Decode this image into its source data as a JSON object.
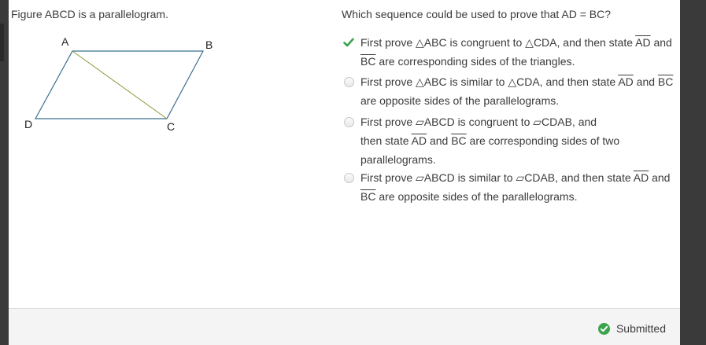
{
  "left_panel": {
    "prompt": "Figure ABCD is a parallelogram.",
    "vertex_labels": {
      "A": "A",
      "B": "B",
      "C": "C",
      "D": "D"
    }
  },
  "right_panel": {
    "question": "Which sequence could be used to prove that AD = BC?",
    "options": [
      {
        "state": "correct-checked",
        "icon": "checkmark-icon",
        "pre": "First prove △ABC is congruent to △CDA, and then state ",
        "seg1": "AD",
        "mid": " and ",
        "seg2": "BC",
        "post": " are corresponding sides of the triangles."
      },
      {
        "state": "unselected",
        "pre": "First prove △ABC is similar to △CDA, and then state ",
        "seg1": "AD",
        "mid": " and ",
        "seg2": "BC",
        "post": " are opposite sides of the parallelograms."
      },
      {
        "state": "unselected",
        "pre": "First prove ▱ABCD is congruent to ▱CDAB, and then state  ",
        "seg1": "AD",
        "mid": " and ",
        "seg2": "BC",
        "post": "  are corresponding sides of two parallelograms."
      },
      {
        "state": "unselected",
        "pre": "First prove ▱ABCD is similar to ▱CDAB, and then state ",
        "seg1": "AD",
        "mid": " and ",
        "seg2": "BC",
        "post": " are opposite sides of the parallelograms."
      }
    ]
  },
  "footer": {
    "status_text": "Submitted",
    "status_color": "#3aa34b"
  }
}
